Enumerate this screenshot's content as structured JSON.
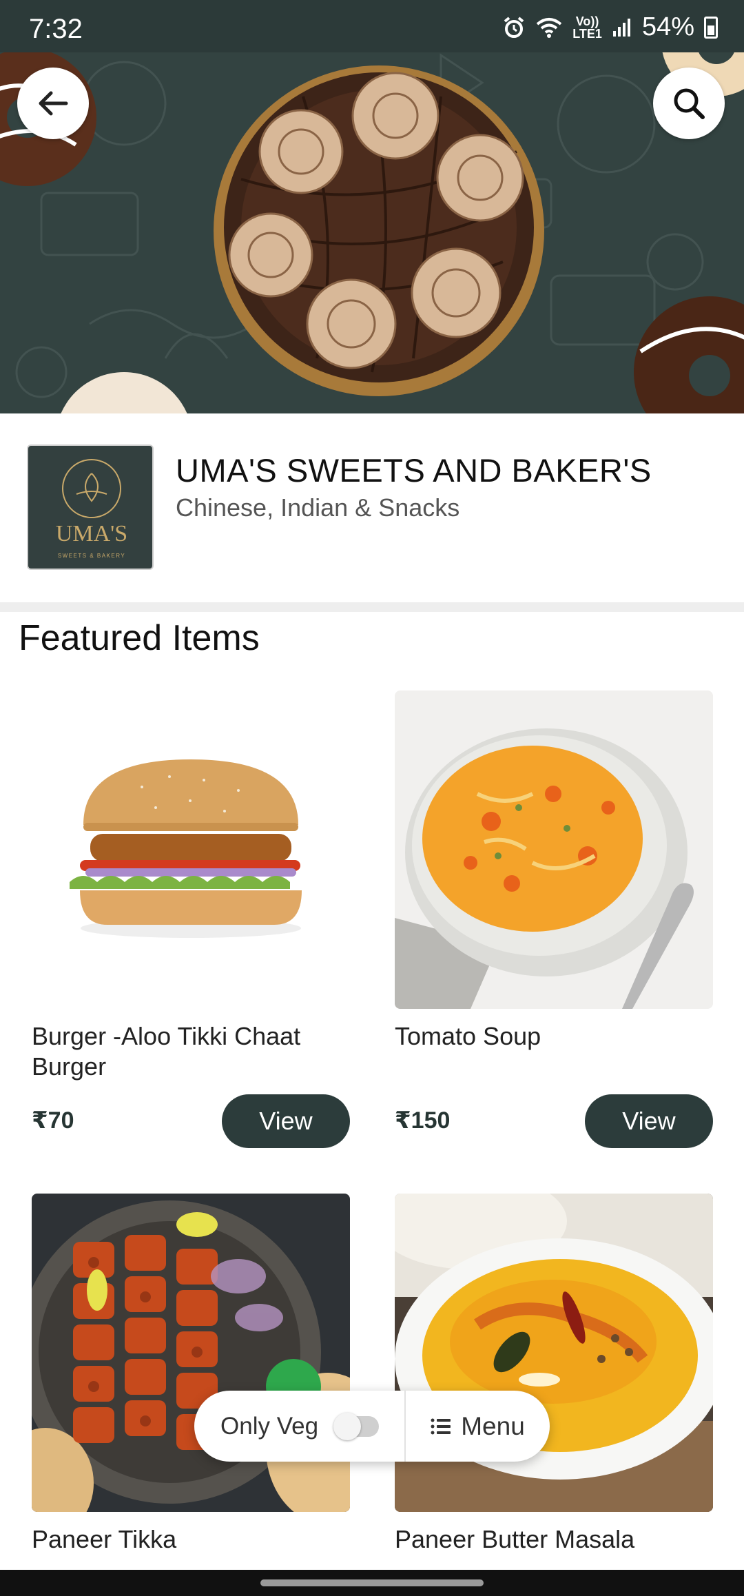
{
  "status_bar": {
    "time": "7:32",
    "network": "Vo))\nLTE1",
    "battery": "54%"
  },
  "restaurant": {
    "name": "UMA'S SWEETS AND BAKER'S",
    "cuisine": "Chinese, Indian & Snacks",
    "logo_text": "UMA'S",
    "logo_subtext": "SWEETS & BAKERY"
  },
  "featured": {
    "title": "Featured Items",
    "items": [
      {
        "name": "Burger -Aloo Tikki Chaat Burger",
        "price": "₹70",
        "view_label": "View"
      },
      {
        "name": "Tomato Soup",
        "price": "₹150",
        "view_label": "View"
      },
      {
        "name": "Paneer Tikka"
      },
      {
        "name": "Paneer Butter Masala"
      }
    ]
  },
  "floating_bar": {
    "veg_label": "Only Veg",
    "veg_enabled": false,
    "menu_label": "Menu"
  },
  "colors": {
    "accent": "#2c3c3b",
    "hero_bg": "#334341"
  }
}
